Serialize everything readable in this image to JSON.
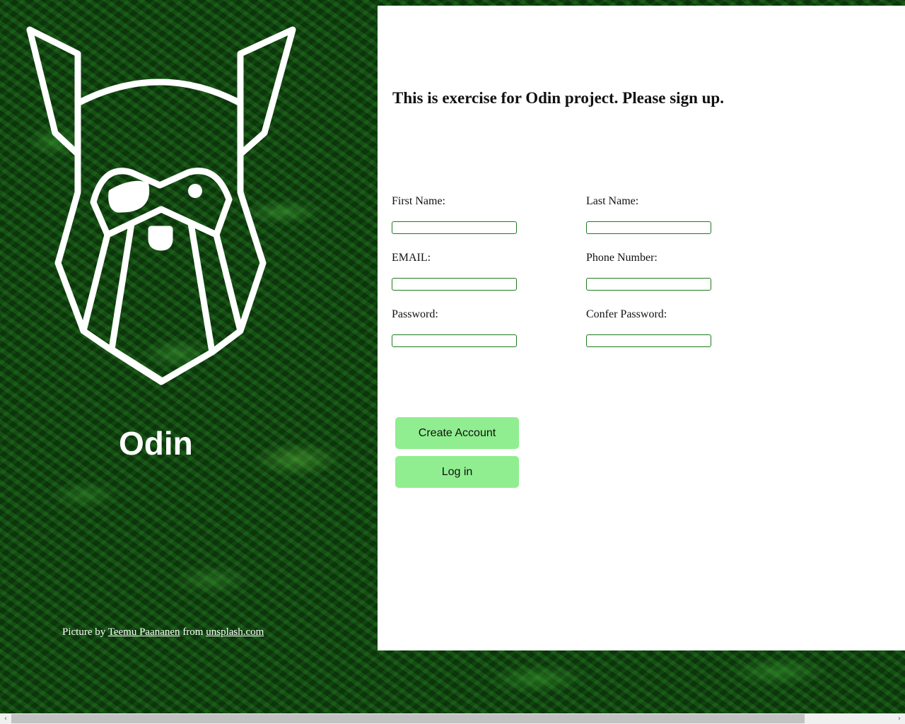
{
  "brand": {
    "name": "Odin",
    "logo_icon": "odin-viking-head-icon"
  },
  "credit": {
    "prefix": "Picture by",
    "author": "Teemu Paananen",
    "middle": "from",
    "site": "unsplash.com"
  },
  "form": {
    "heading": "This is exercise for Odin project. Please sign up.",
    "fields": {
      "first_name": {
        "label": "First Name:",
        "value": ""
      },
      "last_name": {
        "label": "Last Name:",
        "value": ""
      },
      "email": {
        "label": "EMAIL:",
        "value": ""
      },
      "phone": {
        "label": "Phone Number:",
        "value": ""
      },
      "password": {
        "label": "Password:",
        "value": ""
      },
      "confirm_password": {
        "label": "Confer Password:",
        "value": ""
      }
    },
    "buttons": {
      "create_account": "Create Account",
      "log_in": "Log in"
    }
  },
  "scrollbar": {
    "left_arrow": "‹",
    "right_arrow": "›"
  },
  "colors": {
    "button_bg": "#90ee90",
    "input_border": "#1f7a1f",
    "panel_bg": "#ffffff"
  }
}
